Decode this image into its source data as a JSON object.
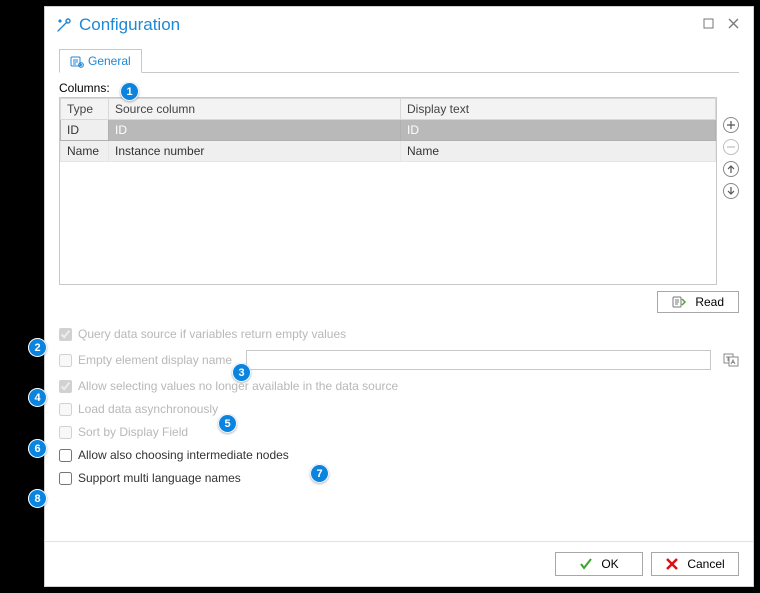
{
  "window": {
    "title": "Configuration"
  },
  "tabs": {
    "general": "General"
  },
  "columns": {
    "label": "Columns:",
    "headers": {
      "type": "Type",
      "source": "Source column",
      "display": "Display text"
    },
    "rows": [
      {
        "type": "ID",
        "source": "ID",
        "display": "ID"
      },
      {
        "type": "Name",
        "source": "Instance number",
        "display": "Name"
      }
    ]
  },
  "buttons": {
    "read": "Read",
    "ok": "OK",
    "cancel": "Cancel"
  },
  "options": {
    "query_empty": "Query data source if variables return empty values",
    "empty_display": "Empty element display name",
    "empty_display_value": "",
    "allow_unavailable": "Allow selecting values no longer available in the data source",
    "load_async": "Load data asynchronously",
    "sort_display": "Sort by Display Field",
    "allow_intermediate": "Allow also choosing intermediate nodes",
    "multi_lang": "Support multi language names"
  },
  "annotations": [
    "1",
    "2",
    "3",
    "4",
    "5",
    "6",
    "7",
    "8"
  ]
}
